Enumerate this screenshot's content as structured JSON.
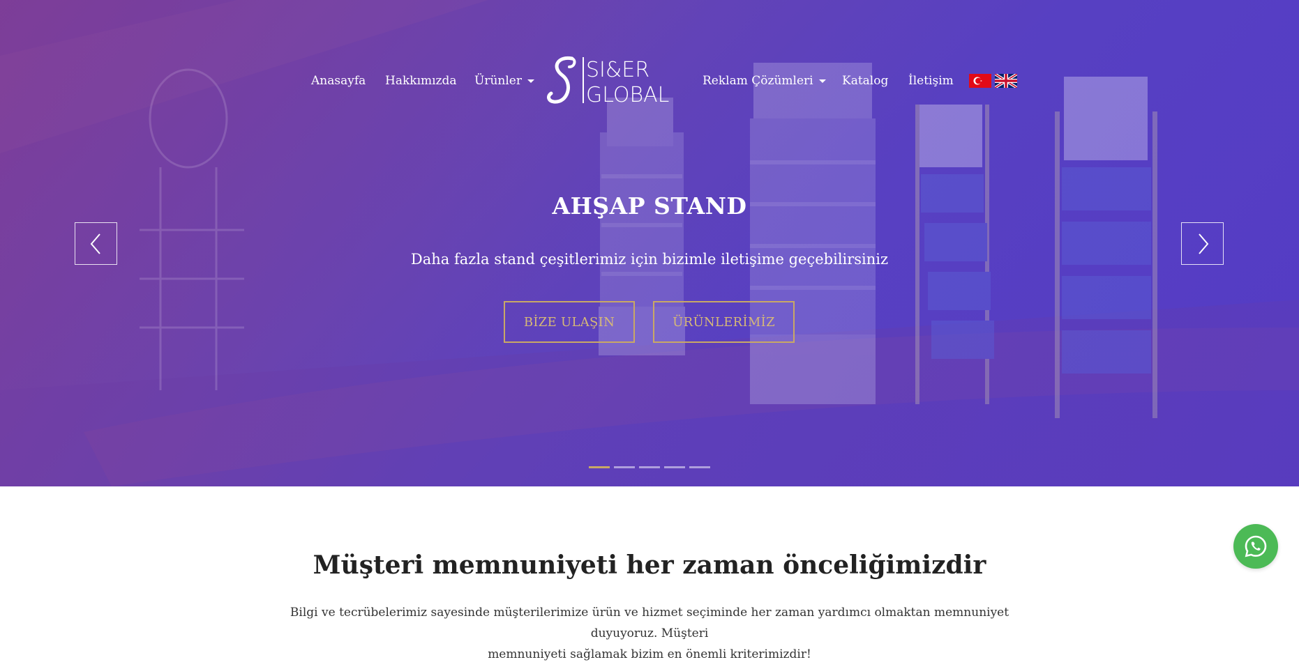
{
  "nav": {
    "items": [
      {
        "label": "Anasayfa"
      },
      {
        "label": "Hakkımızda"
      },
      {
        "label": "Ürünler"
      },
      {
        "label": "Reklam Çözümleri"
      },
      {
        "label": "Katalog"
      },
      {
        "label": "İletişim"
      }
    ],
    "logo": {
      "line1": "SI&ER",
      "line2": "GLOBAL"
    },
    "flags": [
      "turkish-flag-icon",
      "uk-flag-icon"
    ]
  },
  "hero": {
    "title": "AHŞAP STAND",
    "subtitle": "Daha fazla stand çeşitlerimiz için bizimle iletişime geçebilirsiniz",
    "buttons": [
      {
        "label": "BİZE ULAŞIN"
      },
      {
        "label": "ÜRÜNLERİMİZ"
      }
    ],
    "slides_total": 5,
    "active_slide": 1,
    "accent_color": "#c9a865"
  },
  "section": {
    "title": "Müşteri memnuniyeti her zaman önceliğimizdir",
    "text_line1": "Bilgi ve tecrübelerimiz sayesinde müşterilerimize ürün ve hizmet seçiminde her zaman yardımcı olmaktan memnuniyet duyuyoruz. Müşteri",
    "text_line2": "memnuniyeti sağlamak bizim en önemli kriterimizdir!"
  },
  "whatsapp": {
    "icon": "whatsapp-icon",
    "color": "#4cba56"
  }
}
